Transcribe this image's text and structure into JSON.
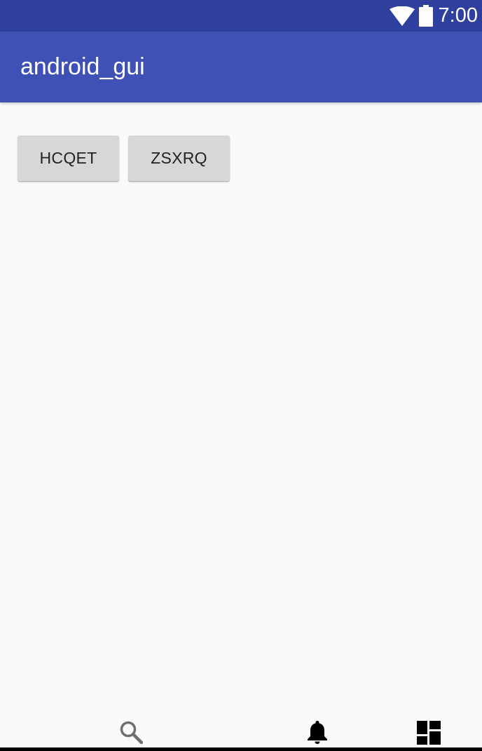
{
  "status_bar": {
    "time": "7:00",
    "background_color": "#2f3f9e",
    "icons": [
      "wifi-icon",
      "battery-icon"
    ]
  },
  "app_bar": {
    "title": "android_gui",
    "background_color": "#3f51b5"
  },
  "content": {
    "buttons": [
      {
        "label": "HCQET"
      },
      {
        "label": "ZSXRQ"
      }
    ]
  },
  "bottom_nav": {
    "items": [
      {
        "icon": "search-icon"
      },
      {
        "icon": "bell-icon"
      },
      {
        "icon": "dashboard-icon"
      }
    ]
  }
}
